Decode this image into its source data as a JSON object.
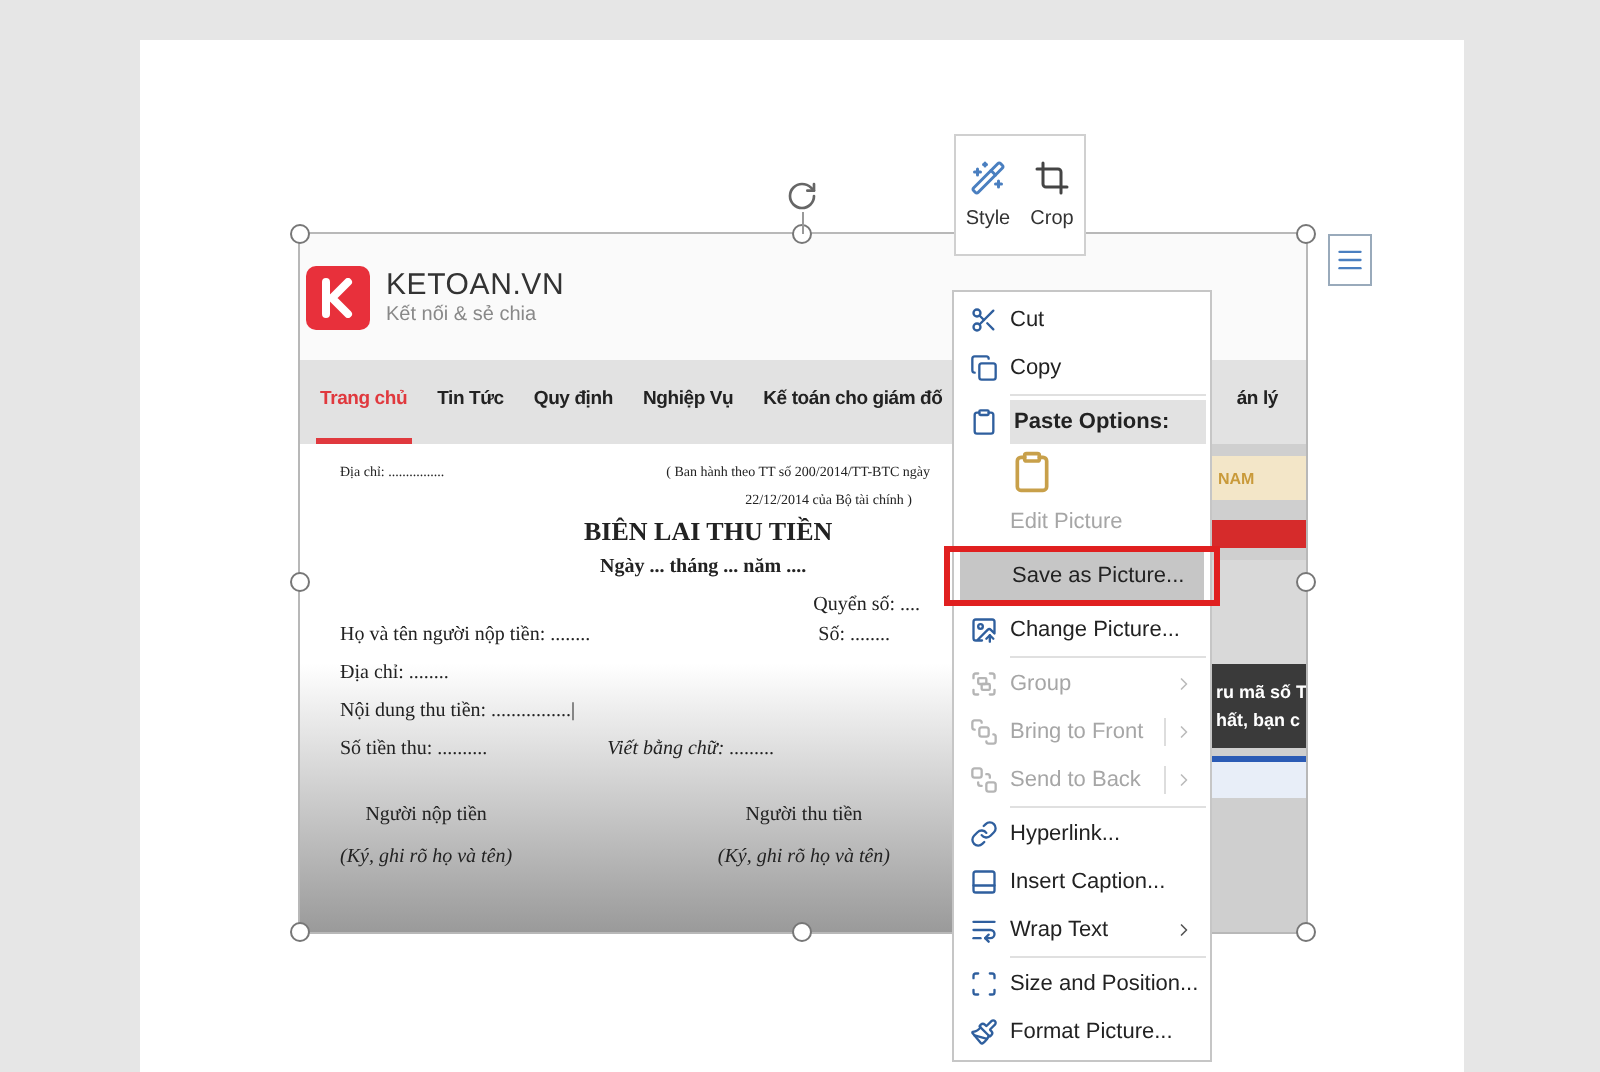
{
  "picture": {
    "site": {
      "logo_title": "KETOAN.VN",
      "logo_tagline": "Kết nối & sẻ chia",
      "nav": [
        {
          "label": "Trang chủ",
          "selected": true
        },
        {
          "label": "Tin Tức",
          "selected": false
        },
        {
          "label": "Quy định",
          "selected": false
        },
        {
          "label": "Nghiệp Vụ",
          "selected": false
        },
        {
          "label": "Kế toán cho giám đố",
          "selected": false
        },
        {
          "label": "án lý",
          "selected": false
        }
      ]
    },
    "document": {
      "address_top": "Địa chỉ: ................",
      "issued_by": "( Ban hành theo TT số 200/2014/TT-BTC ngày",
      "issued_date": "22/12/2014 của Bộ tài chính )",
      "title": "BIÊN LAI THU TIỀN",
      "date_line": "Ngày ... tháng ... năm ....",
      "book_no": "Quyển số: ....",
      "payer": "Họ và tên người nộp tiền: ........",
      "number": "Số: ........",
      "address": "Địa chỉ: ........",
      "content": "Nội dung thu tiền: ................|",
      "amount": "Số tiền thu: ..........",
      "amount_words": "Viết bằng chữ: .........",
      "signatures": [
        {
          "role": "Người nộp tiền",
          "note": "(Ký, ghi rõ họ và tên)"
        },
        {
          "role": "Người thu tiền",
          "note": "(Ký, ghi rõ họ và tên)"
        }
      ]
    },
    "side_strip": {
      "banner": "NAM",
      "headline_1": "ru mã số T",
      "headline_2": "hất, bạn c"
    }
  },
  "mini_toolbar": [
    {
      "label": "Style"
    },
    {
      "label": "Crop"
    }
  ],
  "context_menu": [
    {
      "kind": "command",
      "label": "Cut",
      "disabled": false,
      "selected": false,
      "submenu": false
    },
    {
      "kind": "command",
      "label": "Copy",
      "disabled": false,
      "selected": false,
      "submenu": false
    },
    {
      "kind": "header",
      "label": "Paste Options:"
    },
    {
      "kind": "paste_choice"
    },
    {
      "kind": "command",
      "label": "Edit Picture",
      "disabled": true,
      "selected": false,
      "submenu": false
    },
    {
      "kind": "command",
      "label": "Save as Picture...",
      "disabled": false,
      "selected": true,
      "submenu": false
    },
    {
      "kind": "command",
      "label": "Change Picture...",
      "disabled": false,
      "selected": false,
      "submenu": false
    },
    {
      "kind": "command",
      "label": "Group",
      "disabled": true,
      "selected": false,
      "submenu": true
    },
    {
      "kind": "command",
      "label": "Bring to Front",
      "disabled": true,
      "selected": false,
      "submenu": true
    },
    {
      "kind": "command",
      "label": "Send to Back",
      "disabled": true,
      "selected": false,
      "submenu": true
    },
    {
      "kind": "command",
      "label": "Hyperlink...",
      "disabled": false,
      "selected": false,
      "submenu": false
    },
    {
      "kind": "command",
      "label": "Insert Caption...",
      "disabled": false,
      "selected": false,
      "submenu": false
    },
    {
      "kind": "command",
      "label": "Wrap Text",
      "disabled": false,
      "selected": false,
      "submenu": true
    },
    {
      "kind": "command",
      "label": "Size and Position...",
      "disabled": false,
      "selected": false,
      "submenu": false
    },
    {
      "kind": "command",
      "label": "Format Picture...",
      "disabled": false,
      "selected": false,
      "submenu": false
    }
  ]
}
